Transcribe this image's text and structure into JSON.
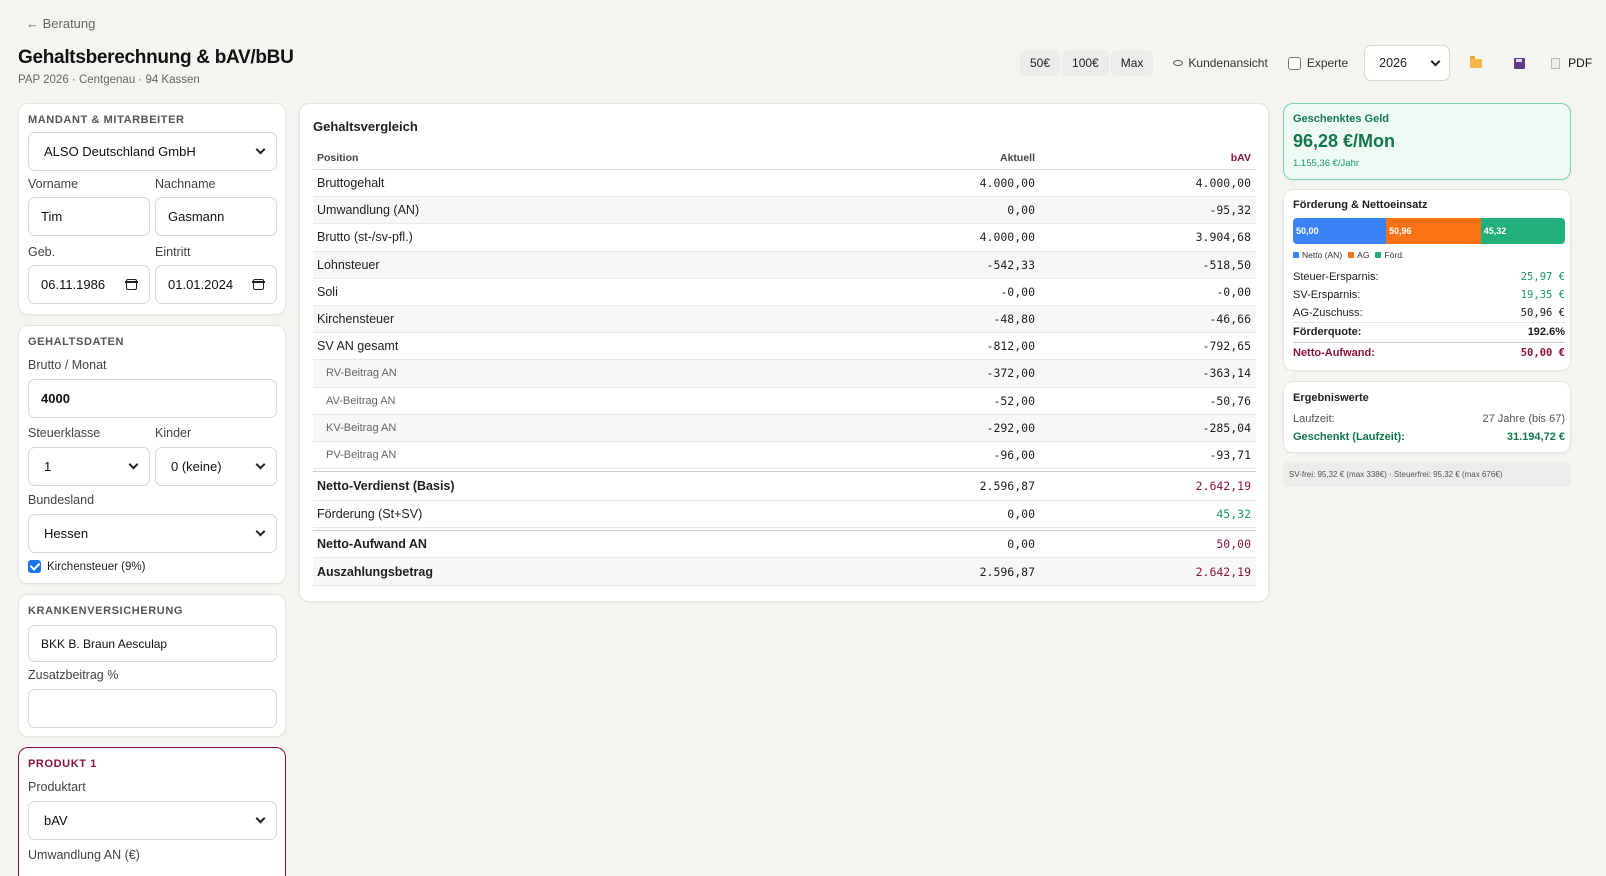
{
  "nav": {
    "back_label": "← Beratung"
  },
  "page": {
    "title": "Gehaltsberechnung & bAV/bBU",
    "subtitle": "PAP 2026 · Centgenau · 94 Kassen"
  },
  "toolbar": {
    "btn_50": "50€",
    "btn_100": "100€",
    "btn_max": "Max",
    "kunden_label": "Kundenansicht",
    "experte_label": "Experte",
    "year": "2026",
    "pdf_label": "PDF"
  },
  "mandant": {
    "section_title": "MANDANT & MITARBEITER",
    "company": "ALSO Deutschland GmbH",
    "vorname_label": "Vorname",
    "vorname": "Tim",
    "nachname_label": "Nachname",
    "nachname": "Gasmann",
    "geb_label": "Geb.",
    "geb": "06.11.1986",
    "eintritt_label": "Eintritt",
    "eintritt": "01.01.2024"
  },
  "gehalt": {
    "section_title": "GEHALTSDATEN",
    "brutto_label": "Brutto / Monat",
    "brutto": "4000",
    "stkl_label": "Steuerklasse",
    "stkl": "1",
    "kinder_label": "Kinder",
    "kinder": "0 (keine)",
    "bundesland_label": "Bundesland",
    "bundesland": "Hessen",
    "kirchensteuer_label": "Kirchensteuer (9%)"
  },
  "kv": {
    "section_title": "KRANKENVERSICHERUNG",
    "kasse": "BKK B. Braun Aesculap",
    "zusatz_label": "Zusatzbeitrag %",
    "zusatz": ""
  },
  "produkt": {
    "section_title": "PRODUKT 1",
    "art_label": "Produktart",
    "art": "bAV",
    "umwandlung_label": "Umwandlung AN (€)"
  },
  "vergleich": {
    "title": "Gehaltsvergleich",
    "headers": {
      "position": "Position",
      "aktuell": "Aktuell",
      "bav": "bAV"
    },
    "rows": [
      {
        "label": "Bruttogehalt",
        "aktuell": "4.000,00",
        "bav": "4.000,00"
      },
      {
        "label": "Umwandlung (AN)",
        "aktuell": "0,00",
        "bav": "-95,32"
      },
      {
        "label": "Brutto (st-/sv-pfl.)",
        "aktuell": "4.000,00",
        "bav": "3.904,68"
      },
      {
        "label": "Lohnsteuer",
        "aktuell": "-542,33",
        "bav": "-518,50"
      },
      {
        "label": "Soli",
        "aktuell": "-0,00",
        "bav": "-0,00"
      },
      {
        "label": "Kirchensteuer",
        "aktuell": "-48,80",
        "bav": "-46,66"
      },
      {
        "label": "SV AN gesamt",
        "aktuell": "-812,00",
        "bav": "-792,65"
      },
      {
        "label": "RV-Beitrag AN",
        "aktuell": "-372,00",
        "bav": "-363,14"
      },
      {
        "label": "AV-Beitrag AN",
        "aktuell": "-52,00",
        "bav": "-50,76"
      },
      {
        "label": "KV-Beitrag AN",
        "aktuell": "-292,00",
        "bav": "-285,04"
      },
      {
        "label": "PV-Beitrag AN",
        "aktuell": "-96,00",
        "bav": "-93,71"
      }
    ],
    "netto": {
      "label": "Netto-Verdienst (Basis)",
      "aktuell": "2.596,87",
      "bav": "2.642,19"
    },
    "foerderung": {
      "label": "Förderung (St+SV)",
      "aktuell": "0,00",
      "bav": "45,32"
    },
    "aufwand": {
      "label": "Netto-Aufwand AN",
      "aktuell": "0,00",
      "bav": "50,00"
    },
    "auszahlung": {
      "label": "Auszahlungsbetrag",
      "aktuell": "2.596,87",
      "bav": "2.642,19"
    }
  },
  "geschenkt": {
    "title": "Geschenktes Geld",
    "amount": "96,28 €/Mon",
    "per_year": "1.155,36 €/Jahr"
  },
  "foerderung": {
    "title": "Förderung & Nettoeinsatz",
    "bar": [
      {
        "label": "50,00",
        "value": 50.0,
        "color": "#3b82f6"
      },
      {
        "label": "50,96",
        "value": 50.96,
        "color": "#f97316"
      },
      {
        "label": "45,32",
        "value": 45.32,
        "color": "#22b07a"
      }
    ],
    "legend": [
      "Netto (AN)",
      "AG",
      "Förd."
    ],
    "steuer_label": "Steuer-Ersparnis:",
    "steuer": "25,97 €",
    "sv_label": "SV-Ersparnis:",
    "sv": "19,35 €",
    "ag_label": "AG-Zuschuss:",
    "ag": "50,96 €",
    "quote_label": "Förderquote:",
    "quote": "192.6%",
    "aufwand_label": "Netto-Aufwand:",
    "aufwand": "50,00 €"
  },
  "ergebnis": {
    "title": "Ergebniswerte",
    "laufzeit_label": "Laufzeit:",
    "laufzeit": "27 Jahre (bis 67)",
    "geschenkt_label": "Geschenkt (Laufzeit):",
    "geschenkt": "31.194,72 €"
  },
  "footnote": "SV-frei: 95,32 € (max 338€) · Steuerfrei: 95,32 € (max 676€)"
}
